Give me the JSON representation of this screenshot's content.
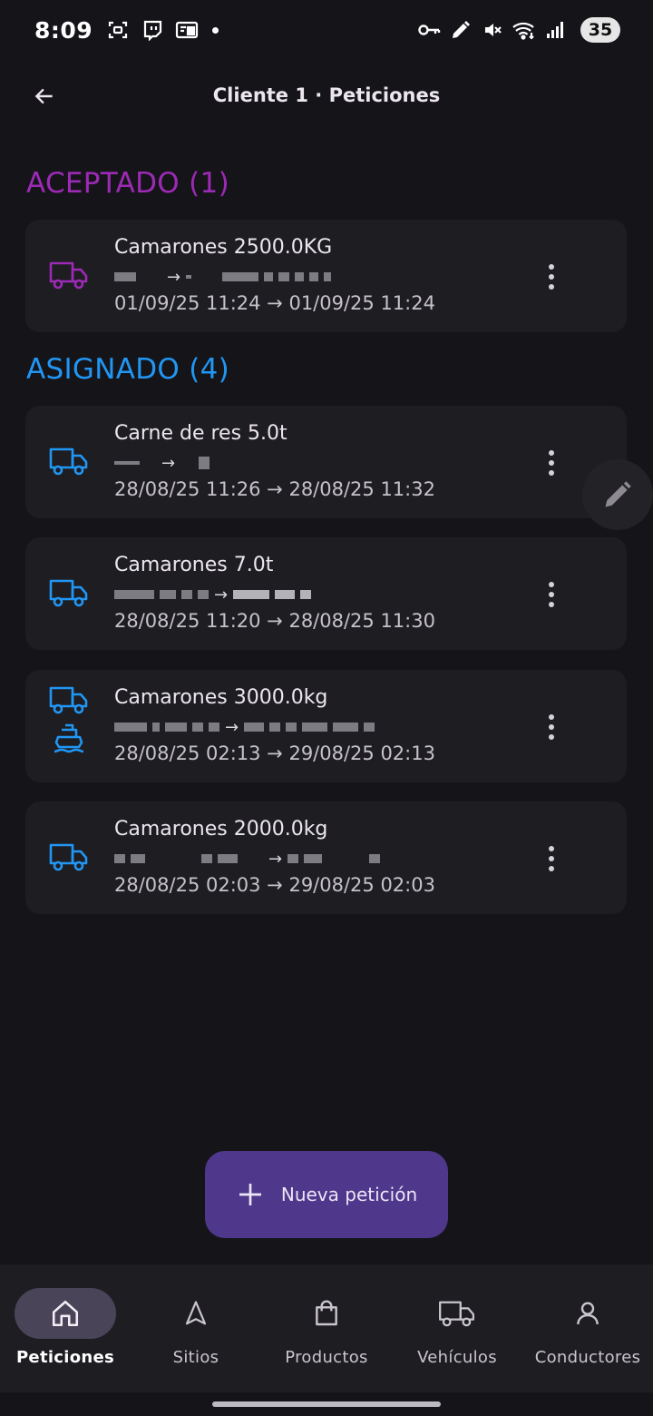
{
  "status_bar": {
    "time": "8:09",
    "battery": "35",
    "left_icons": [
      "screenshot-icon",
      "twitch-icon",
      "cast-icon"
    ],
    "right_icons": [
      "key-icon",
      "pen-icon",
      "mute-icon",
      "wifi-icon",
      "signal-icon"
    ]
  },
  "app_bar": {
    "title": "Cliente 1 · Peticiones"
  },
  "sections": {
    "accepted": {
      "title": "ACEPTADO (1)",
      "color": "#9c2ab5"
    },
    "assigned": {
      "title": "ASIGNADO (4)",
      "color": "#2196f3"
    }
  },
  "requests": [
    {
      "title": "Camarones 2500.0KG",
      "dates": "01/09/25 11:24 → 01/09/25 11:24",
      "route_arrow": "→",
      "icons": [
        "truck-icon"
      ]
    },
    {
      "title": "Carne de res 5.0t",
      "dates": "28/08/25 11:26 → 28/08/25 11:32",
      "route_arrow": "→",
      "icons": [
        "truck-icon"
      ]
    },
    {
      "title": "Camarones 7.0t",
      "dates": "28/08/25 11:20 → 28/08/25 11:30",
      "route_arrow": "→",
      "icons": [
        "truck-icon"
      ]
    },
    {
      "title": "Camarones 3000.0kg",
      "dates": "28/08/25 02:13 → 29/08/25 02:13",
      "route_arrow": "→",
      "icons": [
        "truck-icon",
        "ship-icon"
      ]
    },
    {
      "title": "Camarones 2000.0kg",
      "dates": "28/08/25 02:03 → 29/08/25 02:03",
      "route_arrow": "→",
      "icons": [
        "truck-icon"
      ]
    }
  ],
  "fab": {
    "label": "Nueva petición",
    "icon": "plus-icon",
    "color": "#4f378b"
  },
  "bottom_nav": [
    {
      "label": "Peticiones",
      "icon": "home-icon",
      "active": true
    },
    {
      "label": "Sitios",
      "icon": "navigation-icon",
      "active": false
    },
    {
      "label": "Productos",
      "icon": "shopping-bag-icon",
      "active": false
    },
    {
      "label": "Vehículos",
      "icon": "truck-icon",
      "active": false
    },
    {
      "label": "Conductores",
      "icon": "person-icon",
      "active": false
    }
  ]
}
